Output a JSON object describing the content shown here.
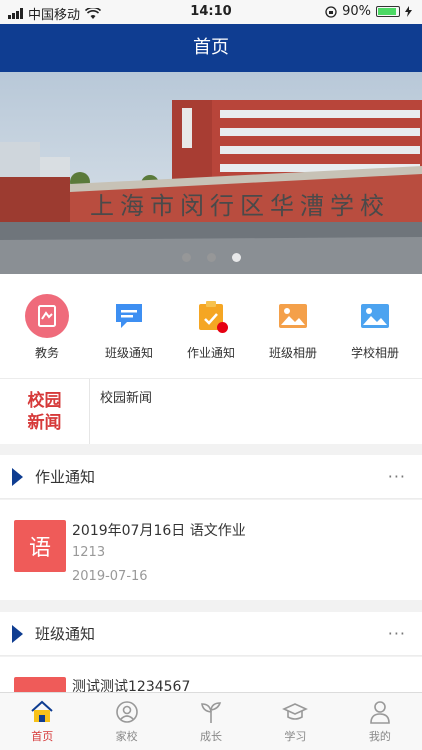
{
  "status_bar": {
    "carrier": "中国移动",
    "time": "14:10",
    "battery": "90%"
  },
  "nav": {
    "title": "首页"
  },
  "banner": {
    "sign_text": "上海市闵行区华漕学校",
    "slides": 3,
    "active_slide": 3
  },
  "quick_menu": [
    {
      "label": "教务",
      "icon": "teaching-affairs-icon"
    },
    {
      "label": "班级通知",
      "icon": "class-notice-icon"
    },
    {
      "label": "作业通知",
      "icon": "homework-notice-icon",
      "badge": true
    },
    {
      "label": "班级相册",
      "icon": "class-album-icon"
    },
    {
      "label": "学校相册",
      "icon": "school-album-icon"
    }
  ],
  "news": {
    "logo_line1": "校园",
    "logo_line2": "新闻",
    "text": "校园新闻"
  },
  "homework": {
    "title": "作业通知",
    "more": "···",
    "item": {
      "thumb": "语",
      "title": "2019年07月16日 语文作业",
      "subtitle": "1213",
      "date": "2019-07-16"
    }
  },
  "class_notice": {
    "title": "班级通知",
    "more": "···",
    "item": {
      "title": "测试测试1234567"
    }
  },
  "tabs": [
    {
      "label": "首页",
      "icon": "home-icon",
      "active": true
    },
    {
      "label": "家校",
      "icon": "home-school-icon"
    },
    {
      "label": "成长",
      "icon": "growth-icon"
    },
    {
      "label": "学习",
      "icon": "study-icon"
    },
    {
      "label": "我的",
      "icon": "profile-icon"
    }
  ],
  "colors": {
    "nav": "#0f3d91",
    "accent": "#d63a3a",
    "thumb": "#ef5b59"
  }
}
